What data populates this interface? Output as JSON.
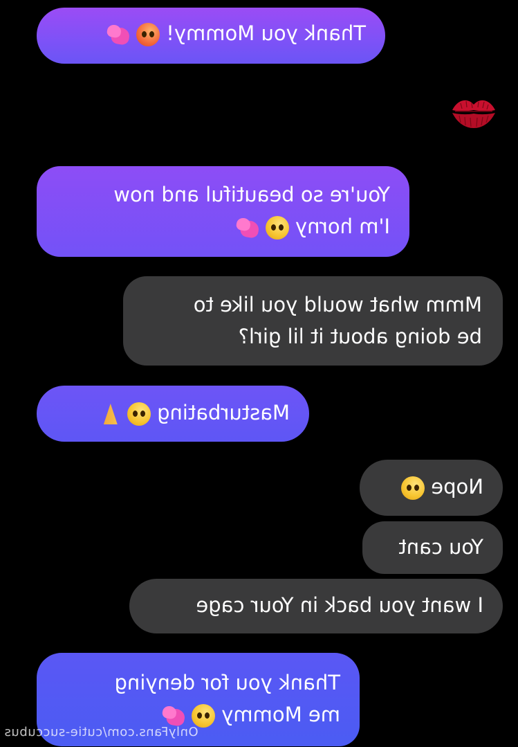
{
  "messages": [
    {
      "id": "b1",
      "side": "left",
      "lines": [
        "Thank you Mommy!"
      ],
      "emoji": [
        "hot-face",
        "sparkling-heart"
      ]
    },
    {
      "id": "b2",
      "side": "left",
      "lines": [
        "You're so beautiful and now",
        "I'm horny"
      ],
      "emoji": [
        "pleading-face",
        "sparkling-heart"
      ]
    },
    {
      "id": "b3",
      "side": "right",
      "lines": [
        "Mmm what would you like to",
        "be doing about it lil girl?"
      ]
    },
    {
      "id": "b4",
      "side": "left",
      "lines": [
        "Masturbating"
      ],
      "emoji": [
        "pleading-face",
        "folded-hands"
      ]
    },
    {
      "id": "b5",
      "side": "right",
      "lines": [
        "Nope"
      ],
      "emoji": [
        "smirking-face"
      ]
    },
    {
      "id": "b6",
      "side": "right",
      "lines": [
        "You cant"
      ]
    },
    {
      "id": "b7",
      "side": "right",
      "lines": [
        "I want you back in Your cage"
      ]
    },
    {
      "id": "b8",
      "side": "left",
      "lines": [
        "Thank you for denying",
        "me Mommy"
      ],
      "emoji": [
        "flushed-face",
        "sparkling-heart"
      ]
    }
  ],
  "reaction": "kiss-mark",
  "watermark": "OnlyFans.com/cutie-succubus",
  "colors": {
    "background": "#000000",
    "sent_bubble": "#3a3a3b",
    "received_gradient_top": "#9b4cf5",
    "received_gradient_bottom": "#4b5cf3"
  }
}
